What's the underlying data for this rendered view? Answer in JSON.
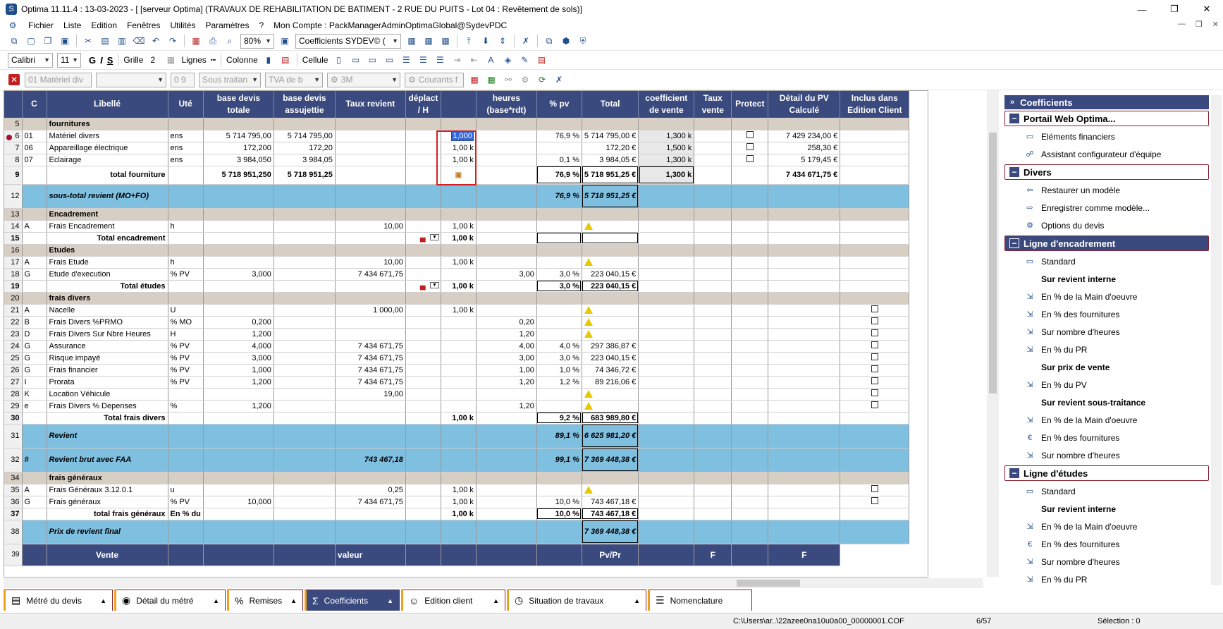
{
  "window": {
    "title": "Optima 11.11.4 : 13-03-2023 - [ [serveur Optima] (TRAVAUX DE REHABILITATION DE BATIMENT - 2 RUE DU PUITS - Lot 04 : Revêtement de sols)]",
    "minimize": "—",
    "maximize": "❐",
    "close": "✕"
  },
  "menu": {
    "items": [
      "Fichier",
      "Liste",
      "Edition",
      "Fenêtres",
      "Utilités",
      "Paramètres",
      "?"
    ],
    "account": "Mon Compte : PackManagerAdminOptimaGlobal@SydevPDC"
  },
  "toolbar1": {
    "zoom": "80%",
    "coefficients_select": "Coefficients  SYDEV© ("
  },
  "toolbar2": {
    "font": "Calibri",
    "size": "11",
    "bold": "G",
    "italic": "I",
    "strike": "S",
    "grille_label": "Grille",
    "grille_value": "2",
    "lignes_label": "Lignes",
    "colonne_label": "Colonne",
    "cellule_label": "Cellule"
  },
  "toolbar3": {
    "material": "01  Matériel div",
    "qty": "0 9",
    "soustraitan": "Sous traitan",
    "tva": "TVA de b",
    "supplier": "3M",
    "courants": "Courants f"
  },
  "grid": {
    "headers": [
      "C",
      "Libellé",
      "Uté",
      "base devis totale",
      "base devis assujettie",
      "Taux revient",
      "déplact / H",
      "",
      "heures (base*rdt)",
      "% pv",
      "Total",
      "coefficient de vente",
      "Taux vente",
      "Protect",
      "Détail du PV Calculé",
      "Inclus dans Edition Client"
    ],
    "rows": [
      {
        "t": "sec",
        "n": "5",
        "lb": "fournitures"
      },
      {
        "t": "row",
        "n": "6",
        "c": "01",
        "lb": "Matériel divers",
        "u": "ens",
        "b1": "5 714 795,00",
        "b2": "5 714 795,00",
        "tr": "",
        "k": "1,000",
        "h": "",
        "pv": "76,9 %",
        "tot": "5 714 795,00 €",
        "cv": "1,300 k",
        "chk": true,
        "d": "7 429 234,00 €",
        "sel": true
      },
      {
        "t": "row",
        "n": "7",
        "c": "06",
        "lb": "Appareillage électrique",
        "u": "ens",
        "b1": "172,200",
        "b2": "172,20",
        "tr": "",
        "k": "1,00 k",
        "h": "",
        "pv": "",
        "tot": "172,20 €",
        "cv": "1,500 k",
        "chk": true,
        "d": "258,30 €"
      },
      {
        "t": "row",
        "n": "8",
        "c": "07",
        "lb": "Eclairage",
        "u": "ens",
        "b1": "3 984,050",
        "b2": "3 984,05",
        "tr": "",
        "k": "1,00 k",
        "h": "",
        "pv": "0,1 %",
        "tot": "3 984,05 €",
        "cv": "1,300 k",
        "chk": true,
        "d": "5 179,45 €"
      },
      {
        "t": "tot9",
        "n": "9",
        "lb": "total fourniture",
        "b1": "5 718 951,250",
        "b2": "5 718 951,25",
        "pv": "76,9 %",
        "tot": "5 718 951,25 €",
        "cv": "1,300 k",
        "d": "7 434 671,75 €"
      },
      {
        "t": "blue",
        "n": "12",
        "lb": "sous-total revient (MO+FO)",
        "pv": "76,9 %",
        "tot": "5 718 951,25 €"
      },
      {
        "t": "sec",
        "n": "13",
        "lb": "Encadrement"
      },
      {
        "t": "row",
        "n": "14",
        "c": "A",
        "lb": "Frais Encadrement",
        "u": "h",
        "tr": "10,00",
        "k": "1,00 k",
        "warn": true
      },
      {
        "t": "tot",
        "n": "15",
        "lb": "Total encadrement",
        "k": "1,00 k",
        "car": true,
        "empty": true
      },
      {
        "t": "sec",
        "n": "16",
        "lb": "Etudes"
      },
      {
        "t": "row",
        "n": "17",
        "c": "A",
        "lb": "Frais Etude",
        "u": "h",
        "tr": "10,00",
        "k": "1,00 k",
        "warn": true
      },
      {
        "t": "row",
        "n": "18",
        "c": "G",
        "lb": "Etude d'execution",
        "u": "% PV",
        "b1": "3,000",
        "tr": "7 434 671,75",
        "h": "3,00",
        "pv": "3,0 %",
        "tot": "223 040,15 €"
      },
      {
        "t": "tot",
        "n": "19",
        "lb": "Total études",
        "k": "1,00 k",
        "pv": "3,0 %",
        "tot": "223 040,15 €",
        "car": true
      },
      {
        "t": "sec",
        "n": "20",
        "lb": "frais divers"
      },
      {
        "t": "row",
        "n": "21",
        "c": "A",
        "lb": "Nacelle",
        "u": "U",
        "tr": "1 000,00",
        "k": "1,00 k",
        "warn": true,
        "inc": true
      },
      {
        "t": "row",
        "n": "22",
        "c": "B",
        "lb": "Frais Divers %PRMO",
        "u": "% MO",
        "b1": "0,200",
        "h": "0,20",
        "warn": true,
        "inc": true
      },
      {
        "t": "row",
        "n": "23",
        "c": "D",
        "lb": "Frais Divers Sur Nbre Heures",
        "u": "H",
        "b1": "1,200",
        "h": "1,20",
        "warn": true,
        "inc": true
      },
      {
        "t": "row",
        "n": "24",
        "c": "G",
        "lb": "Assurance",
        "u": "% PV",
        "b1": "4,000",
        "tr": "7 434 671,75",
        "h": "4,00",
        "pv": "4,0 %",
        "tot": "297 386,87 €",
        "inc": true
      },
      {
        "t": "row",
        "n": "25",
        "c": "G",
        "lb": "Risque impayé",
        "u": "% PV",
        "b1": "3,000",
        "tr": "7 434 671,75",
        "h": "3,00",
        "pv": "3,0 %",
        "tot": "223 040,15 €",
        "inc": true
      },
      {
        "t": "row",
        "n": "26",
        "c": "G",
        "lb": "Frais financier",
        "u": "% PV",
        "b1": "1,000",
        "tr": "7 434 671,75",
        "h": "1,00",
        "pv": "1,0 %",
        "tot": "74 346,72 €",
        "inc": true
      },
      {
        "t": "row",
        "n": "27",
        "c": "I",
        "lb": "Prorata",
        "u": "% PV",
        "b1": "1,200",
        "tr": "7 434 671,75",
        "h": "1,20",
        "pv": "1,2 %",
        "tot": "89 216,06 €",
        "inc": true
      },
      {
        "t": "row",
        "n": "28",
        "c": "K",
        "lb": "Location Véhicule",
        "tr": "19,00",
        "warn": true,
        "inc": true
      },
      {
        "t": "row",
        "n": "29",
        "c": "e",
        "lb": "Frais Divers % Depenses",
        "u": "%",
        "b1": "1,200",
        "h": "1,20",
        "warn": true,
        "inc": true
      },
      {
        "t": "tot",
        "n": "30",
        "lb": "Total frais divers",
        "k": "1,00 k",
        "pv": "9,2 %",
        "tot": "683 989,80 €"
      },
      {
        "t": "blue",
        "n": "31",
        "lb": "Revient",
        "pv": "89,1 %",
        "tot": "6 625 981,20 €"
      },
      {
        "t": "blue",
        "n": "32",
        "c": "#",
        "lb": "Revient brut avec FAA",
        "tr": "743 467,18",
        "pv": "99,1 %",
        "tot": "7 369 448,38 €"
      },
      {
        "t": "sec",
        "n": "34",
        "lb": "frais généraux"
      },
      {
        "t": "row",
        "n": "35",
        "c": "A",
        "lb": "Frais Généraux 3.12.0.1",
        "u": "u",
        "tr": "0,25",
        "k": "1,00 k",
        "warn": true,
        "inc": true
      },
      {
        "t": "row",
        "n": "36",
        "c": "G",
        "lb": "Frais généraux",
        "u": "% PV",
        "b1": "10,000",
        "tr": "7 434 671,75",
        "k": "1,00 k",
        "pv": "10,0 %",
        "tot": "743 467,18 €",
        "inc": true
      },
      {
        "t": "tot",
        "n": "37",
        "lb": "total frais généraux",
        "u": "En % du",
        "k": "1,00 k",
        "pv": "10,0 %",
        "tot": "743 467,18 €"
      },
      {
        "t": "blue",
        "n": "38",
        "lb": "Prix de revient final",
        "tot": "7 369 448,38 €"
      },
      {
        "t": "vente",
        "n": "39",
        "lb": "Vente",
        "tr": "valeur",
        "cv": "Pv/Pr",
        "pr": "F",
        "inc_t": "F"
      }
    ]
  },
  "panel": {
    "title": "Coefficients",
    "groups": [
      {
        "label": "Portail Web Optima...",
        "items": [
          {
            "l": "Eléments financiers",
            "i": "▭"
          },
          {
            "l": "Assistant configurateur d'équipe",
            "i": "☍"
          }
        ]
      },
      {
        "label": "Divers",
        "items": [
          {
            "l": "Restaurer un modèle",
            "i": "⇦"
          },
          {
            "l": "Enregistrer comme modèle...",
            "i": "⇨"
          },
          {
            "l": "Options du devis",
            "i": "⚙"
          }
        ]
      },
      {
        "label": "Ligne d'encadrement",
        "active": true,
        "items": [
          {
            "l": "Standard",
            "i": "▭"
          },
          {
            "l": "Sur revient interne",
            "b": true
          },
          {
            "l": "En % de la Main d'oeuvre",
            "i": "⇲"
          },
          {
            "l": "En % des fournitures",
            "i": "⇲"
          },
          {
            "l": "Sur nombre d'heures",
            "i": "⇲"
          },
          {
            "l": "En % du PR",
            "i": "⇲"
          },
          {
            "l": "Sur prix de vente",
            "b": true
          },
          {
            "l": "En % du PV",
            "i": "⇲"
          },
          {
            "l": "Sur revient sous-traitance",
            "b": true
          },
          {
            "l": "En % de la Main d'oeuvre",
            "i": "⇲"
          },
          {
            "l": "En % des fournitures",
            "i": "€"
          },
          {
            "l": "Sur nombre d'heures",
            "i": "⇲"
          }
        ]
      },
      {
        "label": "Ligne d'études",
        "items": [
          {
            "l": "Standard",
            "i": "▭"
          },
          {
            "l": "Sur revient interne",
            "b": true
          },
          {
            "l": "En % de la Main d'oeuvre",
            "i": "⇲"
          },
          {
            "l": "En % des fournitures",
            "i": "€"
          },
          {
            "l": "Sur nombre d'heures",
            "i": "⇲"
          },
          {
            "l": "En % du PR",
            "i": "⇲"
          }
        ]
      }
    ]
  },
  "tabs": [
    {
      "label": "Métré du devis",
      "icon": "▤"
    },
    {
      "label": "Détail du métré",
      "icon": "◉"
    },
    {
      "label": "Remises",
      "icon": "%"
    },
    {
      "label": "Coefficients",
      "icon": "Σ",
      "active": true
    },
    {
      "label": "Edition client",
      "icon": "☺"
    },
    {
      "label": "Situation de travaux",
      "icon": "◷"
    },
    {
      "label": "Nomenclature",
      "icon": "☰"
    }
  ],
  "status": {
    "path": "C:\\Users\\ar..\\22azee0na10u0a00_00000001.COF",
    "page": "6/57",
    "selection": "Sélection : 0"
  }
}
